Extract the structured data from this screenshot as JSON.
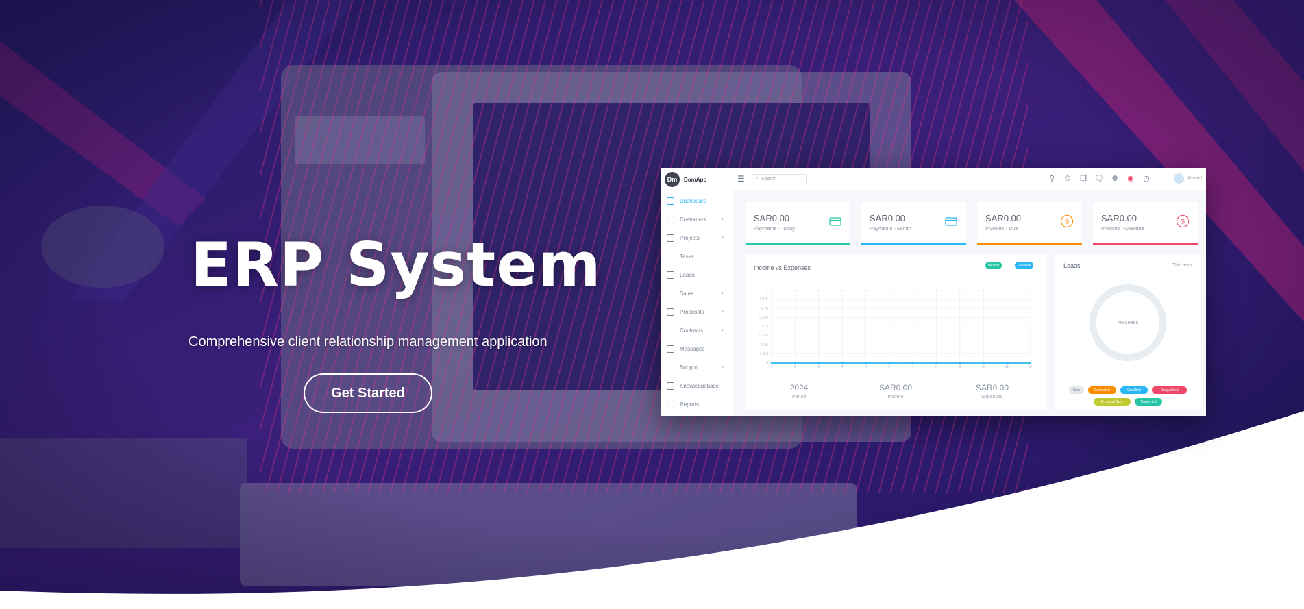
{
  "hero": {
    "title": "ERP System",
    "subtitle": "Comprehensive client relationship management application",
    "cta_label": "Get Started"
  },
  "colors": {
    "hero_bg": "#2a1a6e",
    "accent_pink": "#c2185b",
    "accent_cyan": "#29b6f6",
    "teal": "#26c6a4",
    "orange": "#fb8c00",
    "red": "#f0466a"
  },
  "app": {
    "brand_name": "DomApp",
    "logo_text": "Dm",
    "search_placeholder": "Search",
    "user_name": "Ahmed",
    "top_icons": [
      "bell-icon",
      "timer-icon",
      "copy-icon",
      "chat-icon",
      "gear-icon",
      "lifebuoy-icon",
      "globe-icon"
    ]
  },
  "sidebar": {
    "items": [
      {
        "label": "Dashboard",
        "icon": "home-icon",
        "submenu": false,
        "active": true
      },
      {
        "label": "Customers",
        "icon": "user-icon",
        "submenu": true
      },
      {
        "label": "Projects",
        "icon": "folder-icon",
        "submenu": true
      },
      {
        "label": "Tasks",
        "icon": "list-icon",
        "submenu": false
      },
      {
        "label": "Leads",
        "icon": "phone-icon",
        "submenu": false
      },
      {
        "label": "Sales",
        "icon": "wallet-icon",
        "submenu": true
      },
      {
        "label": "Proposals",
        "icon": "file-icon",
        "submenu": true
      },
      {
        "label": "Contracts",
        "icon": "contract-icon",
        "submenu": true
      },
      {
        "label": "Messages",
        "icon": "message-icon",
        "submenu": false
      },
      {
        "label": "Support",
        "icon": "support-icon",
        "submenu": true
      },
      {
        "label": "Knowledgebase",
        "icon": "book-icon",
        "submenu": false
      },
      {
        "label": "Reports",
        "icon": "chart-icon",
        "submenu": false
      }
    ]
  },
  "cards": [
    {
      "amount": "SAR0.00",
      "label": "Payments - Today",
      "icon": "card-icon",
      "color": "#26c6a4"
    },
    {
      "amount": "SAR0.00",
      "label": "Payments - Month",
      "icon": "card-icon",
      "color": "#29b6f6"
    },
    {
      "amount": "SAR0.00",
      "label": "Invoices - Due",
      "icon": "dollar-icon",
      "color": "#fb8c00"
    },
    {
      "amount": "SAR0.00",
      "label": "Invoices - Overdue",
      "icon": "dollar-icon",
      "color": "#f0466a"
    }
  ],
  "income_chart": {
    "title": "Income vs Expenses",
    "legend": [
      {
        "label": "Income",
        "color": "#26c6a4"
      },
      {
        "label": "Expense",
        "color": "#29b6f6"
      }
    ],
    "stats": [
      {
        "value": "2024",
        "label": "Period"
      },
      {
        "value": "SAR0.00",
        "label": "Income"
      },
      {
        "value": "SAR0.00",
        "label": "Expenses"
      }
    ]
  },
  "chart_data": {
    "type": "line",
    "title": "Income vs Expenses",
    "xlabel": "",
    "ylabel": "",
    "ylim": [
      0,
      1
    ],
    "yticks": [
      "1",
      "0.875",
      "0.75",
      "0.625",
      "0.5",
      "0.375",
      "0.25",
      "0.125",
      "0"
    ],
    "x": [
      "1",
      "2",
      "3",
      "4",
      "5",
      "6",
      "7",
      "8",
      "9",
      "10",
      "11",
      "12"
    ],
    "series": [
      {
        "name": "Income",
        "values": [
          0,
          0,
          0,
          0,
          0,
          0,
          0,
          0,
          0,
          0,
          0,
          0
        ]
      },
      {
        "name": "Expense",
        "values": [
          0,
          0,
          0,
          0,
          0,
          0,
          0,
          0,
          0,
          0,
          0,
          0
        ]
      }
    ],
    "grid": true
  },
  "leads": {
    "title": "Leads",
    "period": "This Year",
    "empty_text": "No Leads",
    "legend": [
      {
        "label": "New",
        "color": "#e3e6ea",
        "text": "#6c7a8c"
      },
      {
        "label": "Contacted",
        "color": "#fb8c00",
        "text": "#ffffff"
      },
      {
        "label": "Qualified",
        "color": "#29b6f6",
        "text": "#ffffff"
      },
      {
        "label": "Disqualified",
        "color": "#f0466a",
        "text": "#ffffff"
      },
      {
        "label": "Proposal Sent",
        "color": "#c0ca33",
        "text": "#ffffff"
      },
      {
        "label": "Converted",
        "color": "#26c6a4",
        "text": "#ffffff"
      }
    ]
  }
}
